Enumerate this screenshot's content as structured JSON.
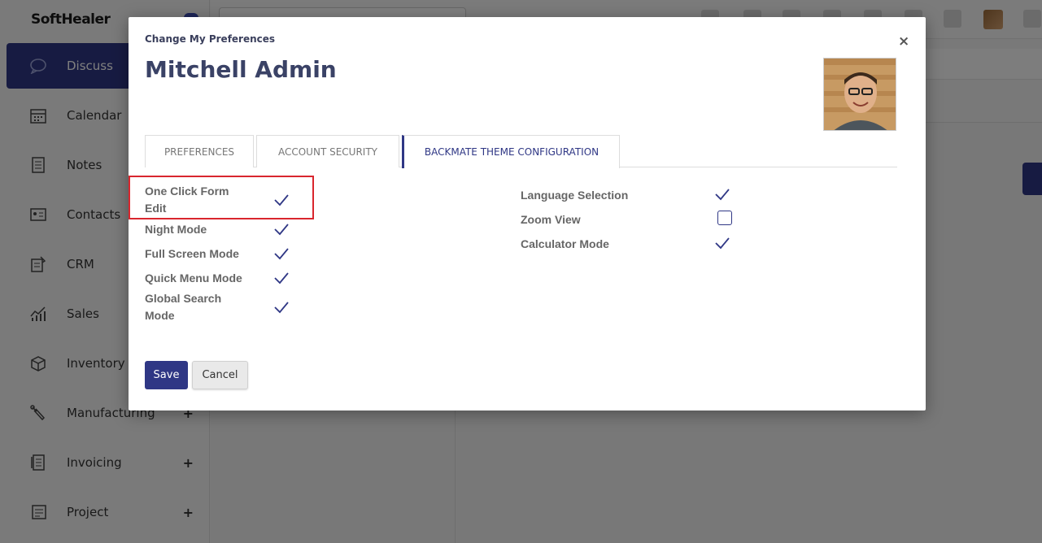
{
  "app": {
    "brand": "SoftHealer",
    "sidebar": [
      {
        "label": "Discuss",
        "icon": "chat-icon",
        "active": true
      },
      {
        "label": "Calendar",
        "icon": "calendar-icon"
      },
      {
        "label": "Notes",
        "icon": "notes-icon"
      },
      {
        "label": "Contacts",
        "icon": "contacts-icon"
      },
      {
        "label": "CRM",
        "icon": "crm-icon"
      },
      {
        "label": "Sales",
        "icon": "sales-chart-icon"
      },
      {
        "label": "Inventory",
        "icon": "box-icon"
      },
      {
        "label": "Manufacturing",
        "icon": "wrench-icon",
        "expand": "+"
      },
      {
        "label": "Invoicing",
        "icon": "invoice-icon",
        "expand": "+"
      },
      {
        "label": "Project",
        "icon": "project-icon",
        "expand": "+"
      }
    ]
  },
  "modal": {
    "title": "Change My Preferences",
    "close_icon": "×",
    "user_name": "Mitchell Admin",
    "tabs": [
      {
        "label": "PREFERENCES"
      },
      {
        "label": "ACCOUNT SECURITY"
      },
      {
        "label": "BACKMATE THEME CONFIGURATION",
        "active": true
      }
    ],
    "left_options": [
      {
        "label_line1": "One Click Form",
        "label_line2": "Edit",
        "checked": true
      },
      {
        "label_line1": "Night Mode",
        "checked": true
      },
      {
        "label_line1": "Full Screen Mode",
        "checked": true
      },
      {
        "label_line1": "Quick Menu Mode",
        "checked": true
      },
      {
        "label_line1": "Global Search",
        "label_line2": "Mode",
        "checked": true
      }
    ],
    "right_options": [
      {
        "label_line1": "Language Selection",
        "checked": true
      },
      {
        "label_line1": "Zoom View",
        "checked": false
      },
      {
        "label_line1": "Calculator Mode",
        "checked": true
      }
    ],
    "save_label": "Save",
    "cancel_label": "Cancel"
  },
  "colors": {
    "accent": "#2f3785",
    "highlight": "#d9262e"
  }
}
